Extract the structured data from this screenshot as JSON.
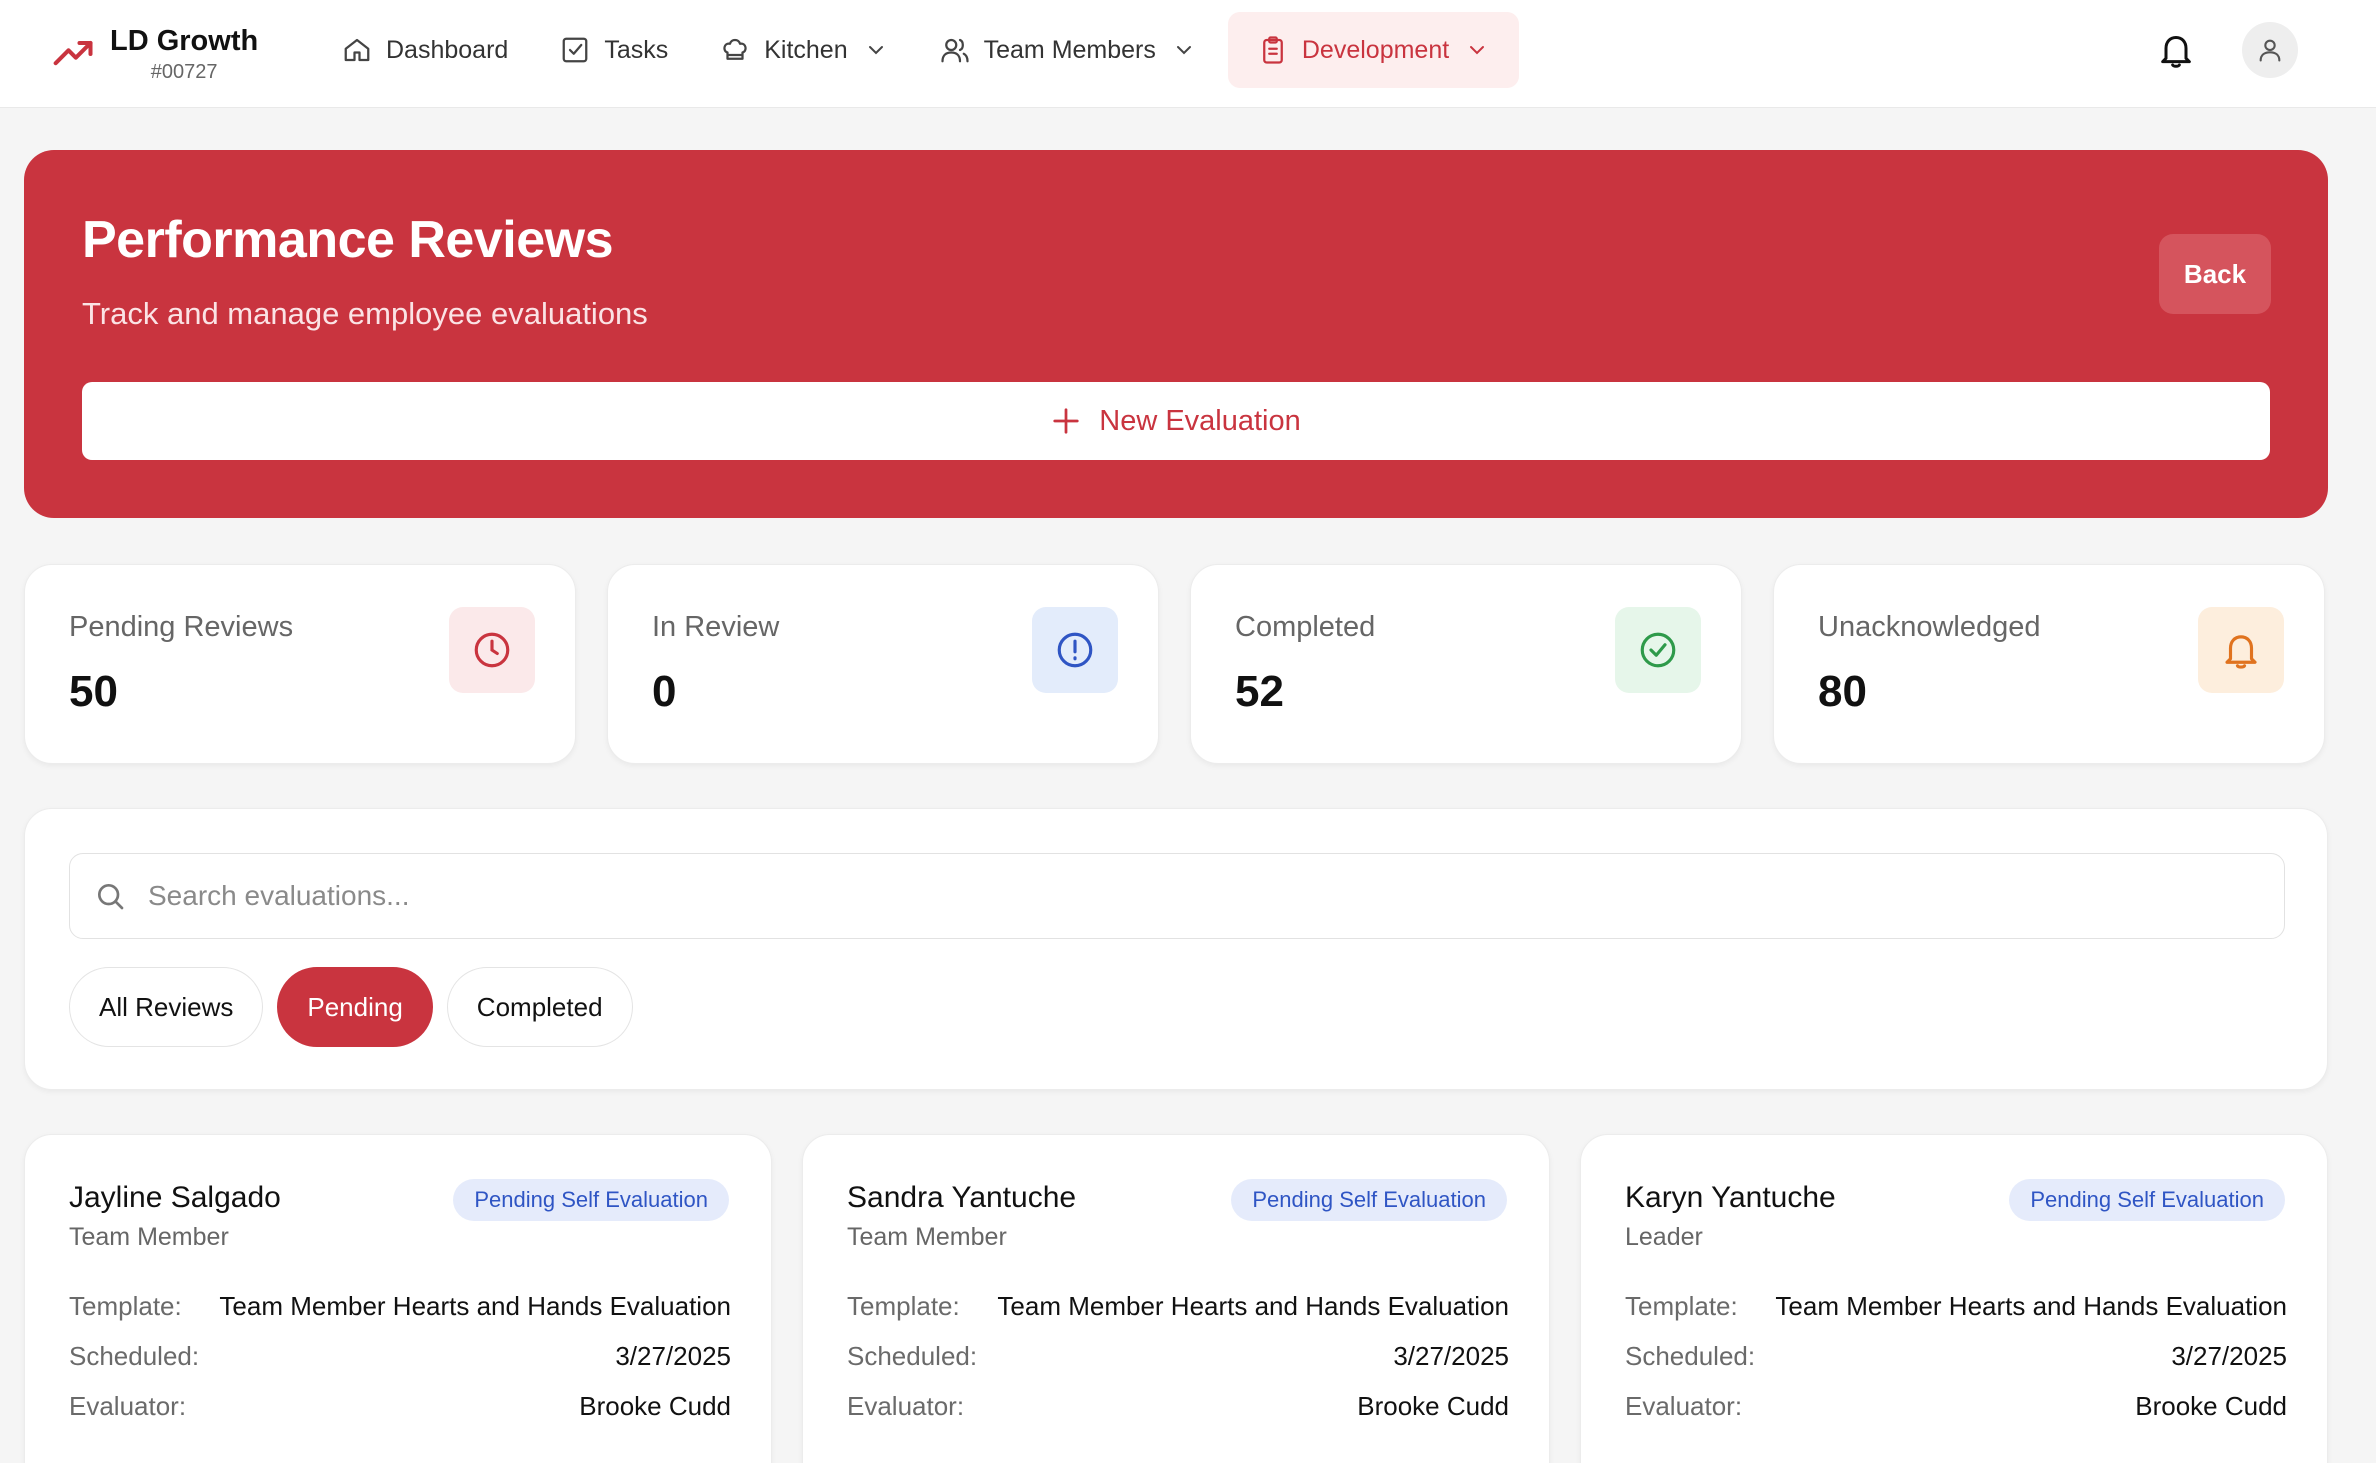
{
  "brand": {
    "title": "LD Growth",
    "subtitle": "#00727"
  },
  "nav": [
    {
      "label": "Dashboard",
      "icon": "home-icon"
    },
    {
      "label": "Tasks",
      "icon": "checkbox-icon"
    },
    {
      "label": "Kitchen",
      "icon": "chef-hat-icon",
      "dropdown": true
    },
    {
      "label": "Team Members",
      "icon": "users-icon",
      "dropdown": true
    },
    {
      "label": "Development",
      "icon": "clipboard-icon",
      "dropdown": true,
      "active": true
    }
  ],
  "hero": {
    "title": "Performance Reviews",
    "subtitle": "Track and manage employee evaluations",
    "back_label": "Back",
    "new_eval_label": "New Evaluation"
  },
  "stats": [
    {
      "label": "Pending Reviews",
      "value": "50",
      "icon": "clock-icon",
      "color": "#c9343f",
      "bg": "#fbe9ea"
    },
    {
      "label": "In Review",
      "value": "0",
      "icon": "alert-circle-icon",
      "color": "#2f55c4",
      "bg": "#e3ecfb"
    },
    {
      "label": "Completed",
      "value": "52",
      "icon": "check-circle-icon",
      "color": "#2e9a4a",
      "bg": "#e6f6ea"
    },
    {
      "label": "Unacknowledged",
      "value": "80",
      "icon": "bell-icon",
      "color": "#e0731f",
      "bg": "#fdeedd"
    }
  ],
  "search": {
    "placeholder": "Search evaluations..."
  },
  "filters": {
    "all": "All Reviews",
    "pending": "Pending",
    "completed": "Completed",
    "active": "Pending"
  },
  "labels": {
    "template": "Template:",
    "scheduled": "Scheduled:",
    "evaluator": "Evaluator:"
  },
  "reviews": [
    {
      "name": "Jayline Salgado",
      "role": "Team Member",
      "status": "Pending Self Evaluation",
      "template": "Team Member Hearts and Hands Evaluation",
      "scheduled": "3/27/2025",
      "evaluator": "Brooke Cudd"
    },
    {
      "name": "Sandra Yantuche",
      "role": "Team Member",
      "status": "Pending Self Evaluation",
      "template": "Team Member Hearts and Hands Evaluation",
      "scheduled": "3/27/2025",
      "evaluator": "Brooke Cudd"
    },
    {
      "name": "Karyn Yantuche",
      "role": "Leader",
      "status": "Pending Self Evaluation",
      "template": "Team Member Hearts and Hands Evaluation",
      "scheduled": "3/27/2025",
      "evaluator": "Brooke Cudd"
    }
  ],
  "colors": {
    "brand_red": "#c9343f",
    "badge_blue": "#2f55c4"
  }
}
